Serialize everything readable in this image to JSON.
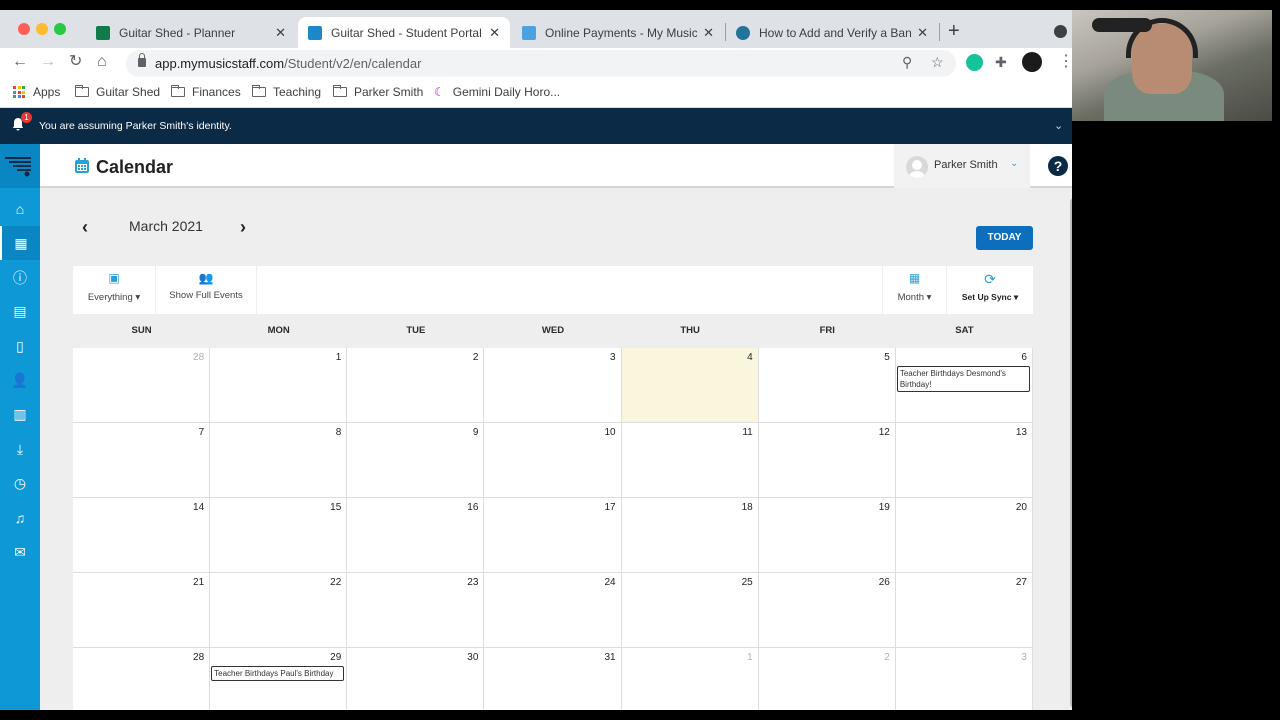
{
  "browser": {
    "tabs": [
      {
        "label": "Guitar Shed - Planner",
        "favicon_color": "#0f7b4a",
        "active": false
      },
      {
        "label": "Guitar Shed - Student Portal",
        "favicon_color": "#1c88c9",
        "active": true
      },
      {
        "label": "Online Payments - My Music St",
        "favicon_color": "#4aa3df",
        "active": false
      },
      {
        "label": "How to Add and Verify a Bank A",
        "favicon_color": "#21759b",
        "active": false
      }
    ],
    "new_tab": "+",
    "close_glyph": "✕",
    "url_domain": "app.mymusicstaff.com",
    "url_path": "/Student/v2/en/calendar",
    "bookmarks": [
      {
        "label": "Apps",
        "icon": "apps-grid-icon"
      },
      {
        "label": "Guitar Shed",
        "icon": "folder-icon"
      },
      {
        "label": "Finances",
        "icon": "folder-icon"
      },
      {
        "label": "Teaching",
        "icon": "folder-icon"
      },
      {
        "label": "Parker Smith",
        "icon": "folder-icon"
      },
      {
        "label": "Gemini Daily Horo...",
        "icon": "moon-icon"
      }
    ]
  },
  "identity_banner": {
    "text": "You are assuming Parker Smith's identity.",
    "notification_count": "1"
  },
  "sidebar": {
    "items": [
      {
        "icon": "home-icon",
        "glyph": "⌂"
      },
      {
        "icon": "calendar-icon",
        "glyph": "▦",
        "active": true
      },
      {
        "icon": "info-icon",
        "glyph": "ⓘ"
      },
      {
        "icon": "id-card-icon",
        "glyph": "▤"
      },
      {
        "icon": "notes-icon",
        "glyph": "▯"
      },
      {
        "icon": "user-check-icon",
        "glyph": "👤"
      },
      {
        "icon": "library-icon",
        "glyph": "▥"
      },
      {
        "icon": "download-icon",
        "glyph": "⤓"
      },
      {
        "icon": "clock-icon",
        "glyph": "◷"
      },
      {
        "icon": "music-note-icon",
        "glyph": "♫"
      },
      {
        "icon": "mail-icon",
        "glyph": "✉"
      }
    ]
  },
  "header": {
    "title": "Calendar",
    "user_name": "Parker Smith",
    "help": "?"
  },
  "calendar": {
    "month_label": "March 2021",
    "today_button": "TODAY",
    "filters": {
      "everything": "Everything ▾",
      "show_full_events": "Show Full Events",
      "month": "Month ▾",
      "sync": "Set Up Sync ▾"
    },
    "days_of_week": [
      "SUN",
      "MON",
      "TUE",
      "WED",
      "THU",
      "FRI",
      "SAT"
    ],
    "weeks": [
      [
        {
          "n": "28",
          "other": true
        },
        {
          "n": "1"
        },
        {
          "n": "2"
        },
        {
          "n": "3"
        },
        {
          "n": "4",
          "today": true
        },
        {
          "n": "5"
        },
        {
          "n": "6",
          "event": "Teacher Birthdays Desmond's Birthday!"
        }
      ],
      [
        {
          "n": "7"
        },
        {
          "n": "8"
        },
        {
          "n": "9"
        },
        {
          "n": "10"
        },
        {
          "n": "11"
        },
        {
          "n": "12"
        },
        {
          "n": "13"
        }
      ],
      [
        {
          "n": "14"
        },
        {
          "n": "15"
        },
        {
          "n": "16"
        },
        {
          "n": "17"
        },
        {
          "n": "18"
        },
        {
          "n": "19"
        },
        {
          "n": "20"
        }
      ],
      [
        {
          "n": "21"
        },
        {
          "n": "22"
        },
        {
          "n": "23"
        },
        {
          "n": "24"
        },
        {
          "n": "25"
        },
        {
          "n": "26"
        },
        {
          "n": "27"
        }
      ],
      [
        {
          "n": "28"
        },
        {
          "n": "29",
          "event": "Teacher Birthdays Paul's Birthday"
        },
        {
          "n": "30"
        },
        {
          "n": "31"
        },
        {
          "n": "1",
          "other": true
        },
        {
          "n": "2",
          "other": true
        },
        {
          "n": "3",
          "other": true
        }
      ]
    ]
  },
  "colors": {
    "sidebar": "#0e99d6",
    "banner": "#0b2a45",
    "today_btn": "#0d6ebd",
    "today_cell": "#faf6dd",
    "accent_blue": "#2a9fd6",
    "accent_green": "#2eaa5c"
  }
}
